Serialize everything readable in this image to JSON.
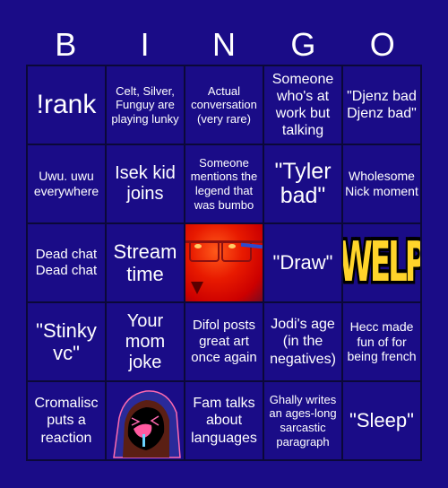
{
  "title_letters": [
    "B",
    "I",
    "N",
    "G",
    "O"
  ],
  "colors": {
    "background": "#1a0c87",
    "grid_line": "#0b0838",
    "text": "#ffffff",
    "welp_yellow": "#ffd42a"
  },
  "cells": [
    {
      "text": "!rank",
      "size": "fs30"
    },
    {
      "text": "Celt, Silver, Funguy are playing lunky",
      "size": "fs13"
    },
    {
      "text": "Actual conversation (very rare)",
      "size": "fs13"
    },
    {
      "text": "Someone who's at work but talking",
      "size": "fs16"
    },
    {
      "text": "\"Djenz bad Djenz bad\"",
      "size": "fs16"
    },
    {
      "text": "Uwu. uwu everywhere",
      "size": "fs14"
    },
    {
      "text": "Isek kid joins",
      "size": "fs20"
    },
    {
      "text": "Someone mentions the legend that was bumbo",
      "size": "fs13"
    },
    {
      "text": "\"Tyler bad\"",
      "size": "fs24"
    },
    {
      "text": "Wholesome Nick moment",
      "size": "fs14"
    },
    {
      "text": "Dead chat Dead chat",
      "size": "fs15"
    },
    {
      "text": "Stream time",
      "size": "fs22"
    },
    {
      "image": "red-face-photo"
    },
    {
      "text": "\"Draw\"",
      "size": "fs22"
    },
    {
      "image": "welp-text-image",
      "label": "WELP"
    },
    {
      "text": "\"Stinky vc\"",
      "size": "fs22"
    },
    {
      "text": "Your mom joke",
      "size": "fs20"
    },
    {
      "text": "Difol posts great art once again",
      "size": "fs15"
    },
    {
      "text": "Jodi's age (in the negatives)",
      "size": "fs16"
    },
    {
      "text": "Hecc made fun of for being french",
      "size": "fs14"
    },
    {
      "text": "Cromalisc puts a reaction",
      "size": "fs16"
    },
    {
      "image": "hooded-crying-character"
    },
    {
      "text": "Fam talks about languages",
      "size": "fs16"
    },
    {
      "text": "Ghally writes an ages-long sarcastic paragraph",
      "size": "fs13"
    },
    {
      "text": "\"Sleep\"",
      "size": "fs22"
    }
  ]
}
